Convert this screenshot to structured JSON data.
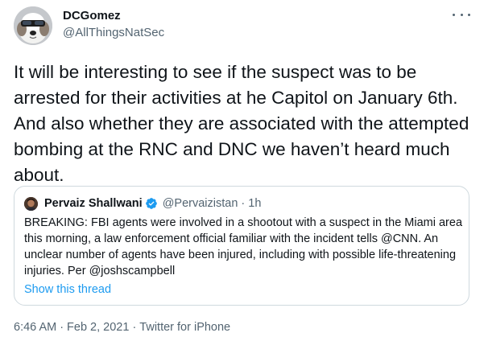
{
  "tweet": {
    "author": {
      "display_name": "DCGomez",
      "handle": "@AllThingsNatSec"
    },
    "more_label": "More",
    "text": "It will be interesting to see if the suspect was to be arrested for their activities at he Capitol on January 6th. And also whether they are associated with the attempted bombing at the RNC and DNC we haven’t heard much about.",
    "quoted": {
      "author_name": "Pervaiz Shallwani",
      "verified": true,
      "handle": "@Pervaizistan",
      "dot": "·",
      "time": "1h",
      "text": "BREAKING: FBI agents were involved in a shootout with a suspect in the Miami area this morning, a law enforcement official familiar with the incident tells @CNN. An unclear number of agents have been injured, including with possible life-threatening injuries. Per @joshscampbell",
      "show_thread": "Show this thread"
    },
    "meta": {
      "time": "6:46 AM",
      "dot": "·",
      "date": "Feb 2, 2021",
      "dot2": "·",
      "source": "Twitter for iPhone"
    }
  },
  "colors": {
    "text": "#0f1419",
    "secondary": "#536471",
    "link": "#1d9bf0",
    "border": "#cfd9de",
    "verified": "#1d9bf0"
  }
}
